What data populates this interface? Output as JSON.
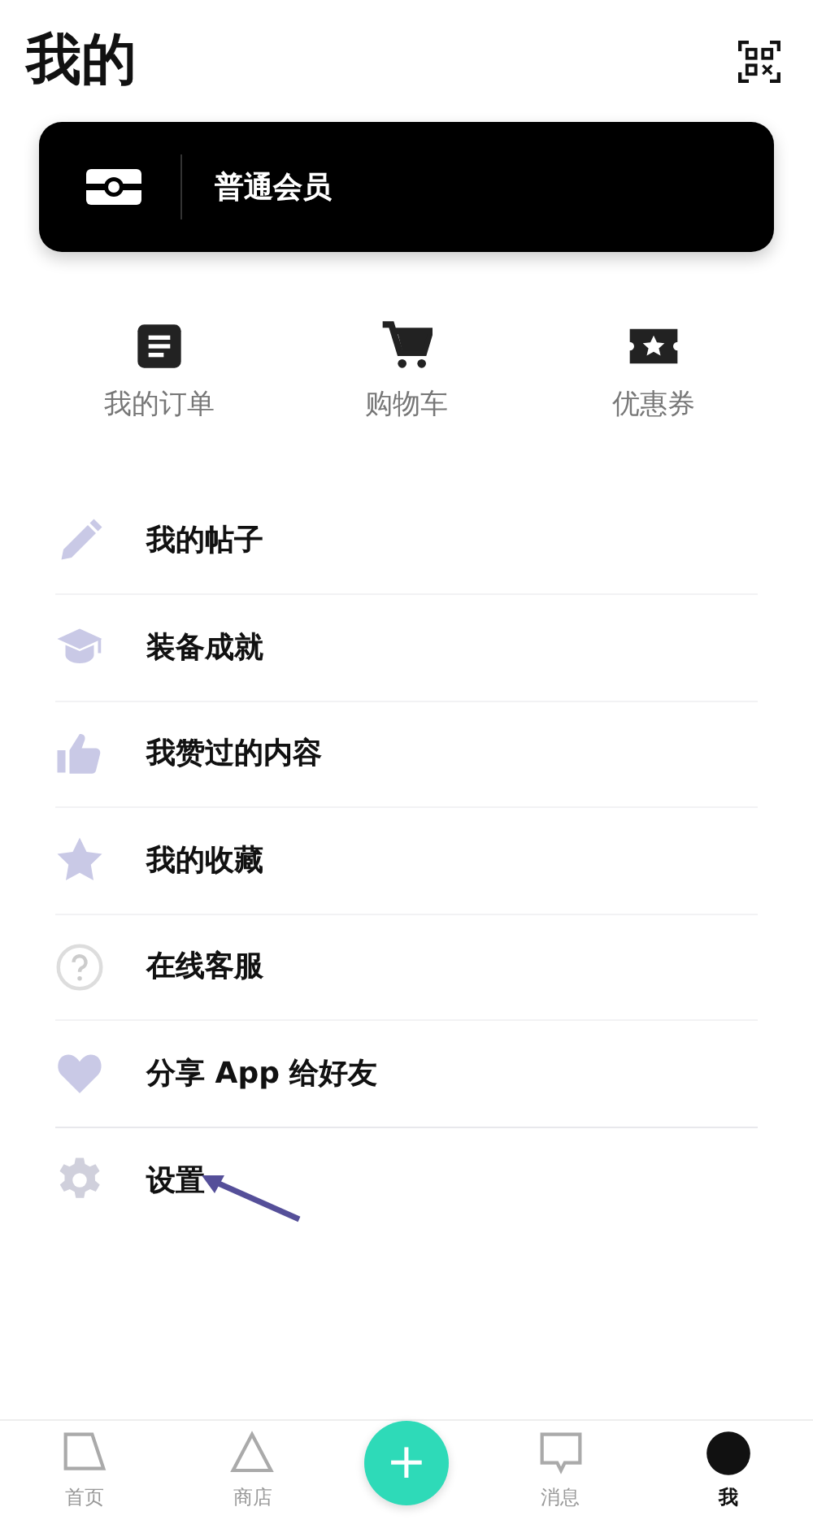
{
  "header": {
    "title": "我的"
  },
  "member_card": {
    "label": "普通会员"
  },
  "quick_actions": [
    {
      "label": "我的订单"
    },
    {
      "label": "购物车"
    },
    {
      "label": "优惠券"
    }
  ],
  "menu": [
    {
      "label": "我的帖子"
    },
    {
      "label": "装备成就"
    },
    {
      "label": "我赞过的内容"
    },
    {
      "label": "我的收藏"
    },
    {
      "label": "在线客服"
    },
    {
      "label": "分享 App 给好友"
    },
    {
      "label": "设置",
      "annotated": true
    }
  ],
  "bottom_nav": [
    {
      "kind": "tab",
      "label": "首页",
      "selected": false
    },
    {
      "kind": "tab",
      "label": "商店",
      "selected": false
    },
    {
      "kind": "fab",
      "label": "+"
    },
    {
      "kind": "tab",
      "label": "消息",
      "selected": false
    },
    {
      "kind": "tab",
      "label": "我",
      "selected": true
    }
  ]
}
